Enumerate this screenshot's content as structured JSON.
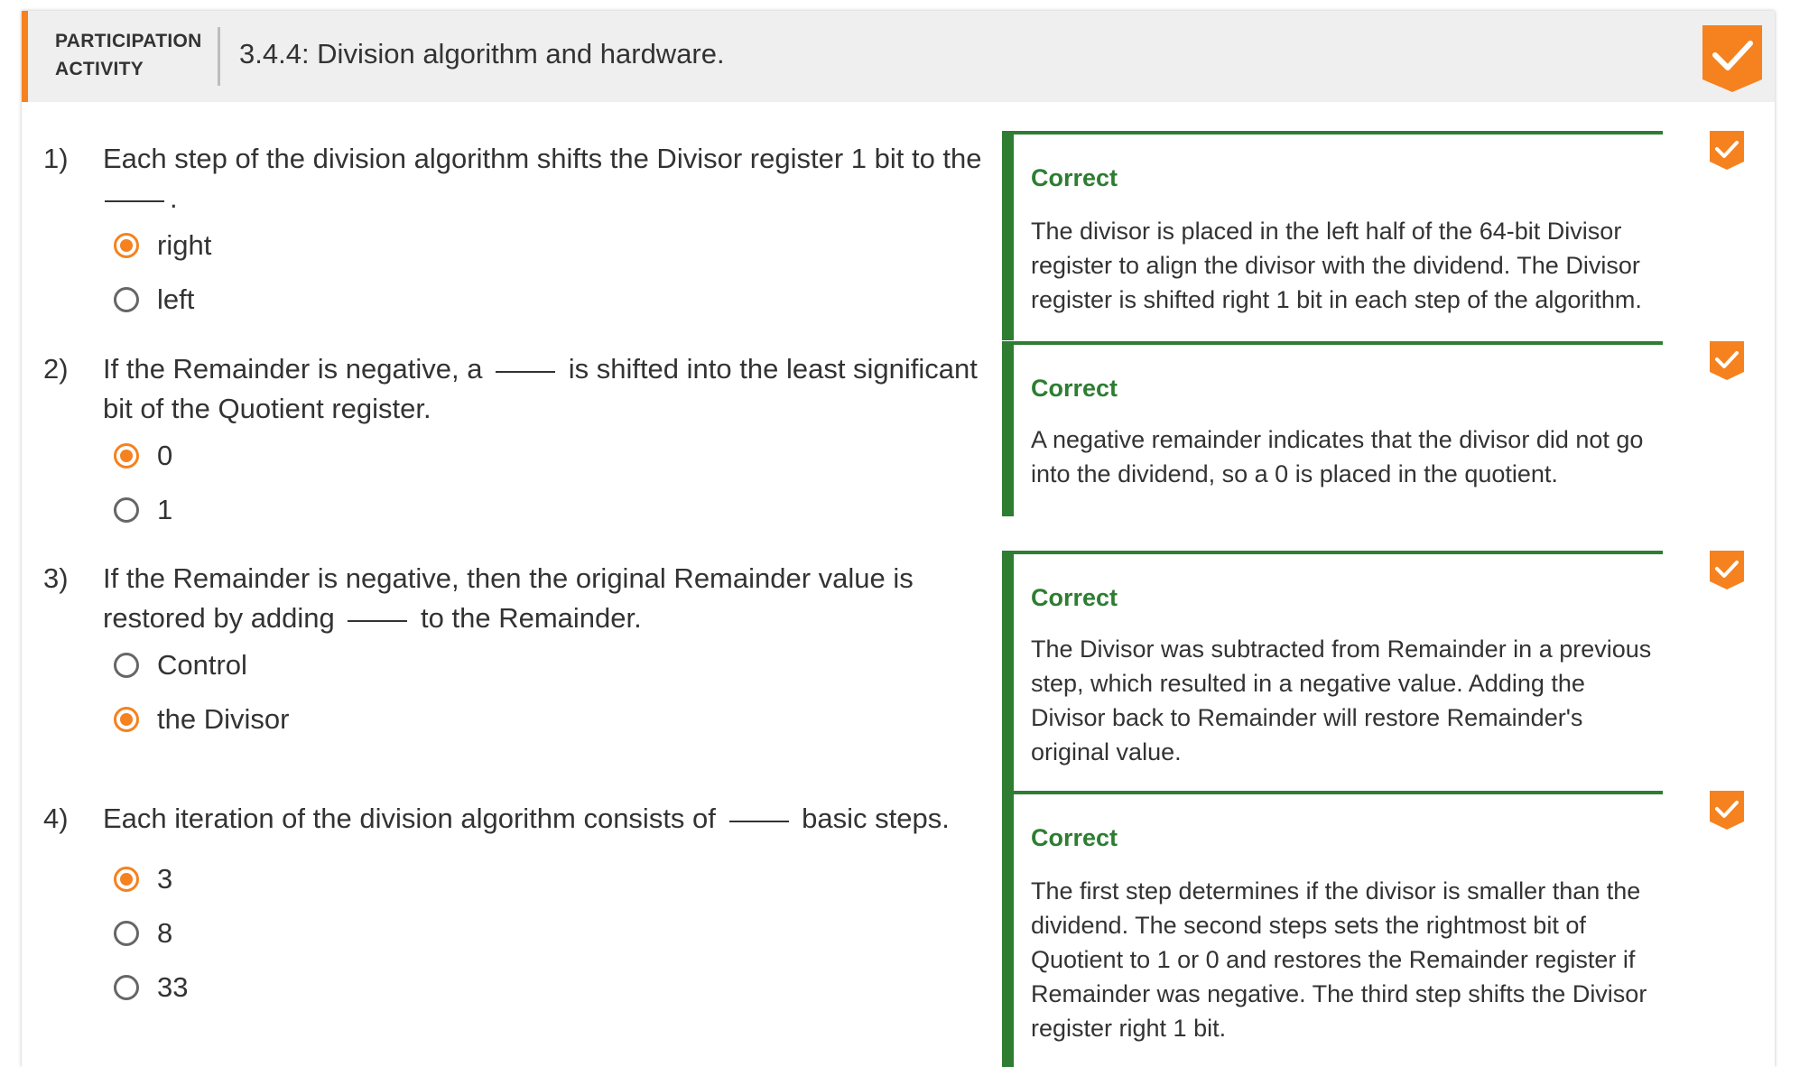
{
  "header": {
    "participation_label": "PARTICIPATION\nACTIVITY",
    "title": "3.4.4: Division algorithm and hardware.",
    "complete_icon": "check-badge-icon"
  },
  "colors": {
    "accent": "#f5821f",
    "correct": "#2e7d32",
    "text": "#333333",
    "header_bg": "#efefef"
  },
  "questions": [
    {
      "number": "1)",
      "text_before": "Each step of the division algorithm shifts the Divisor register 1 bit to the",
      "text_after": ".",
      "choices": [
        {
          "label": "right",
          "selected": true
        },
        {
          "label": "left",
          "selected": false
        }
      ],
      "feedback": {
        "label": "Correct",
        "text": "The divisor is placed in the left half of the 64-bit Divisor register to align the divisor with the dividend. The Divisor register is shifted right 1 bit in each step of the algorithm."
      }
    },
    {
      "number": "2)",
      "text_before": "If the Remainder is negative, a",
      "text_after": "is shifted into the least significant bit of the Quotient register.",
      "choices": [
        {
          "label": "0",
          "selected": true
        },
        {
          "label": "1",
          "selected": false
        }
      ],
      "feedback": {
        "label": "Correct",
        "text": "A negative remainder indicates that the divisor did not go into the dividend, so a 0 is placed in the quotient."
      }
    },
    {
      "number": "3)",
      "text_before": "If the Remainder is negative, then the original Remainder value is restored by adding",
      "text_after": "to the Remainder.",
      "choices": [
        {
          "label": "Control",
          "selected": false
        },
        {
          "label": "the Divisor",
          "selected": true
        }
      ],
      "feedback": {
        "label": "Correct",
        "text": "The Divisor was subtracted from Remainder in a previous step, which resulted in a negative value. Adding the Divisor back to Remainder will restore Remainder's original value."
      }
    },
    {
      "number": "4)",
      "text_before": "Each iteration of the division algorithm consists of",
      "text_after": "basic steps.",
      "choices": [
        {
          "label": "3",
          "selected": true
        },
        {
          "label": "8",
          "selected": false
        },
        {
          "label": "33",
          "selected": false
        }
      ],
      "feedback": {
        "label": "Correct",
        "text": "The first step determines if the divisor is smaller than the dividend. The second steps sets the rightmost bit of Quotient to 1 or 0 and restores the Remainder register if Remainder was negative. The third step shifts the Divisor register right 1 bit."
      }
    }
  ]
}
